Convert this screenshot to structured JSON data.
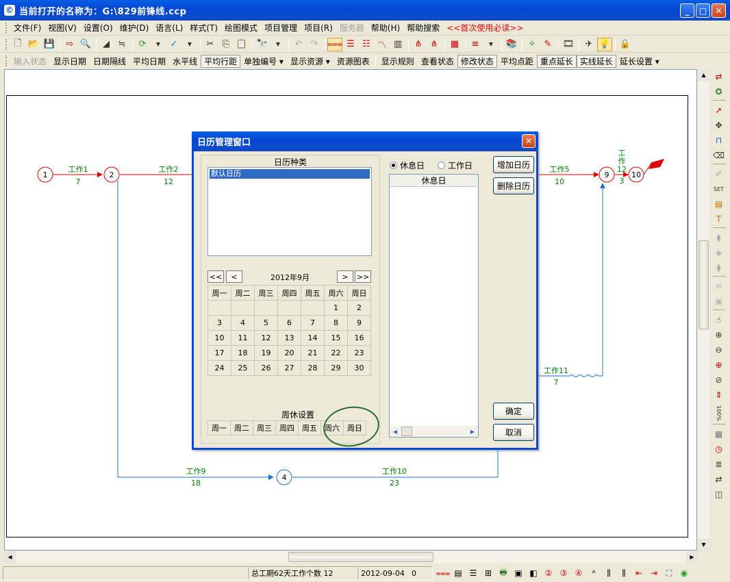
{
  "window": {
    "title": "当前打开的名称为：G:\\829前锋线.ccp",
    "icon": "calendar-app-icon"
  },
  "menu": [
    {
      "label": "文件(F)",
      "state": "normal"
    },
    {
      "label": "视图(V)",
      "state": "normal"
    },
    {
      "label": "设置(O)",
      "state": "normal"
    },
    {
      "label": "维护(D)",
      "state": "normal"
    },
    {
      "label": "语言(L)",
      "state": "normal"
    },
    {
      "label": "样式(T)",
      "state": "normal"
    },
    {
      "label": "绘图模式",
      "state": "normal"
    },
    {
      "label": "项目管理",
      "state": "normal"
    },
    {
      "label": "项目(R)",
      "state": "normal"
    },
    {
      "label": "服务器",
      "state": "disabled"
    },
    {
      "label": "帮助(H)",
      "state": "normal"
    },
    {
      "label": "帮助搜索",
      "state": "normal"
    },
    {
      "label": "<<首次使用必读>>",
      "state": "highlight"
    }
  ],
  "text_toolbar": [
    {
      "label": "输入状态",
      "state": "disabled"
    },
    {
      "label": "显示日期",
      "state": "normal"
    },
    {
      "label": "日期隔线",
      "state": "normal"
    },
    {
      "label": "平均日期",
      "state": "normal"
    },
    {
      "label": "水平线",
      "state": "normal"
    },
    {
      "label": "平均行距",
      "state": "pressed"
    },
    {
      "label": "单独编号 ▾",
      "state": "normal"
    },
    {
      "label": "显示资源 ▾",
      "state": "normal"
    },
    {
      "label": "资源图表",
      "state": "normal"
    },
    {
      "label": "显示规则",
      "state": "normal"
    },
    {
      "label": "查看状态",
      "state": "normal"
    },
    {
      "label": "修改状态",
      "state": "pressed"
    },
    {
      "label": "平均点距",
      "state": "normal"
    },
    {
      "label": "重点延长",
      "state": "pressed"
    },
    {
      "label": "实线延长",
      "state": "pressed"
    },
    {
      "label": "延长设置 ▾",
      "state": "normal"
    }
  ],
  "network": {
    "nodes": [
      "1",
      "2",
      "4",
      "9",
      "10"
    ],
    "activities": [
      {
        "name": "工作1",
        "duration": "7"
      },
      {
        "name": "工作2",
        "duration": "12"
      },
      {
        "name": "工作5",
        "duration": "10"
      },
      {
        "name_l1": "工",
        "name_l2": "作",
        "name_l3": "12",
        "duration": "3"
      },
      {
        "name": "工作11",
        "duration": "7"
      },
      {
        "name": "工作9",
        "duration": "18"
      },
      {
        "name": "工作10",
        "duration": "23"
      }
    ],
    "colors": {
      "critical": "#e00000",
      "normal": "#1e73c8",
      "label": "#008000"
    }
  },
  "dialog": {
    "title": "日历管理窗口",
    "calendar_type_label": "日历种类",
    "calendar_types": [
      "默认日历"
    ],
    "month_label": "2012年9月",
    "nav": [
      "<<",
      "<",
      ">",
      ">>"
    ],
    "weekday_headers": [
      "周一",
      "周二",
      "周三",
      "周四",
      "周五",
      "周六",
      "周日"
    ],
    "days": [
      "",
      "",
      "",
      "",
      "",
      "1",
      "2",
      "3",
      "4",
      "5",
      "6",
      "7",
      "8",
      "9",
      "10",
      "11",
      "12",
      "13",
      "14",
      "15",
      "16",
      "17",
      "18",
      "19",
      "20",
      "21",
      "22",
      "23",
      "24",
      "25",
      "26",
      "27",
      "28",
      "29",
      "30"
    ],
    "week_rest_label": "周休设置",
    "week_rest_days": [
      "周一",
      "周二",
      "周三",
      "周四",
      "周五",
      "周六",
      "周日"
    ],
    "radio_rest": "休息日",
    "radio_work": "工作日",
    "holiday_header": "休息日",
    "buttons": {
      "add": "增加日历",
      "delete": "删除日历",
      "ok": "确定",
      "cancel": "取消"
    }
  },
  "status": {
    "summary": "总工期62天工作个数 12",
    "date": "2012-09-04",
    "value": "0"
  }
}
